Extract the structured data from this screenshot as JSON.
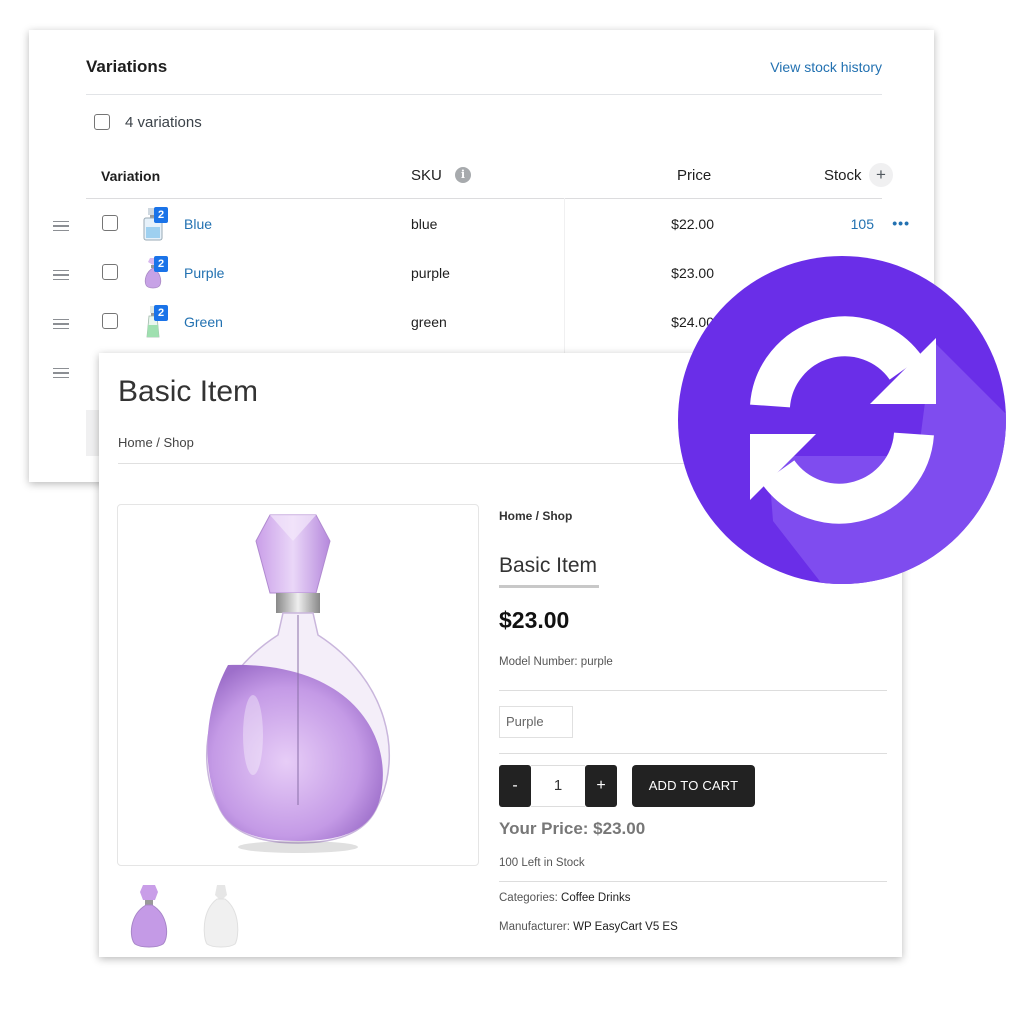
{
  "variations": {
    "title": "Variations",
    "view_history": "View stock history",
    "count_label": "4 variations",
    "columns": {
      "variation": "Variation",
      "sku": "SKU",
      "price": "Price",
      "stock": "Stock"
    },
    "info_icon": "i",
    "add_icon": "+",
    "more_icon": "•••",
    "rows": [
      {
        "name": "Blue",
        "sku": "blue",
        "price": "$22.00",
        "stock": "105",
        "images": "2",
        "color": "#9ed0f0"
      },
      {
        "name": "Purple",
        "sku": "purple",
        "price": "$23.00",
        "stock": "",
        "images": "2",
        "color": "#c7a2e6"
      },
      {
        "name": "Green",
        "sku": "green",
        "price": "$24.00",
        "stock": "",
        "images": "2",
        "color": "#9fe0b0"
      }
    ]
  },
  "product": {
    "title": "Basic Item",
    "breadcrumb": "Home / Shop",
    "inner_breadcrumb": "Home / Shop",
    "name": "Basic Item",
    "price": "$23.00",
    "model_number": "Model Number: purple",
    "selected_variant": "Purple",
    "qty_minus": "-",
    "qty_value": "1",
    "qty_plus": "+",
    "add_to_cart": "ADD TO CART",
    "your_price": "Your Price: $23.00",
    "stock_left": "100 Left in Stock",
    "categories_label": "Categories: ",
    "categories_value": "Coffee Drinks",
    "manufacturer_label": "Manufacturer: ",
    "manufacturer_value": "WP EasyCart V5 ES"
  },
  "sync_badge": {
    "icon": "sync-icon",
    "color": "#6a2ee8"
  }
}
